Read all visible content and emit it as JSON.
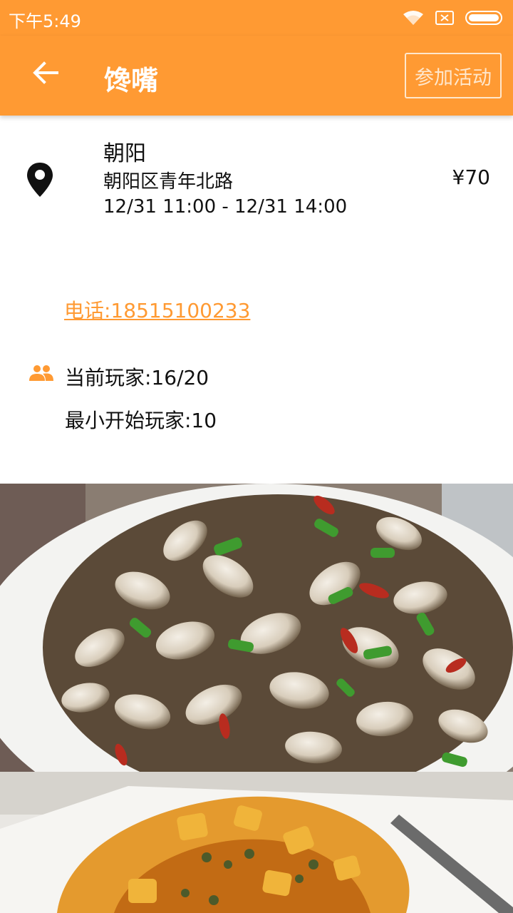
{
  "status_bar": {
    "time": "下午5:49",
    "icons": [
      "wifi-icon",
      "sim-icon",
      "battery-icon"
    ]
  },
  "app_bar": {
    "back_icon": "arrow-left-icon",
    "title": "馋嘴",
    "action_label": "参加活动"
  },
  "event": {
    "location_icon": "map-pin-icon",
    "name": "朝阳",
    "address": "朝阳区青年北路",
    "time": "12/31 11:00 - 12/31 14:00",
    "price": "¥70",
    "phone": "电话:18515100233",
    "players_icon": "group-icon",
    "current_players": "当前玩家:16/20",
    "min_players": "最小开始玩家:10"
  },
  "colors": {
    "accent": "#FF9A33",
    "action_border": "#FFE7CC"
  }
}
